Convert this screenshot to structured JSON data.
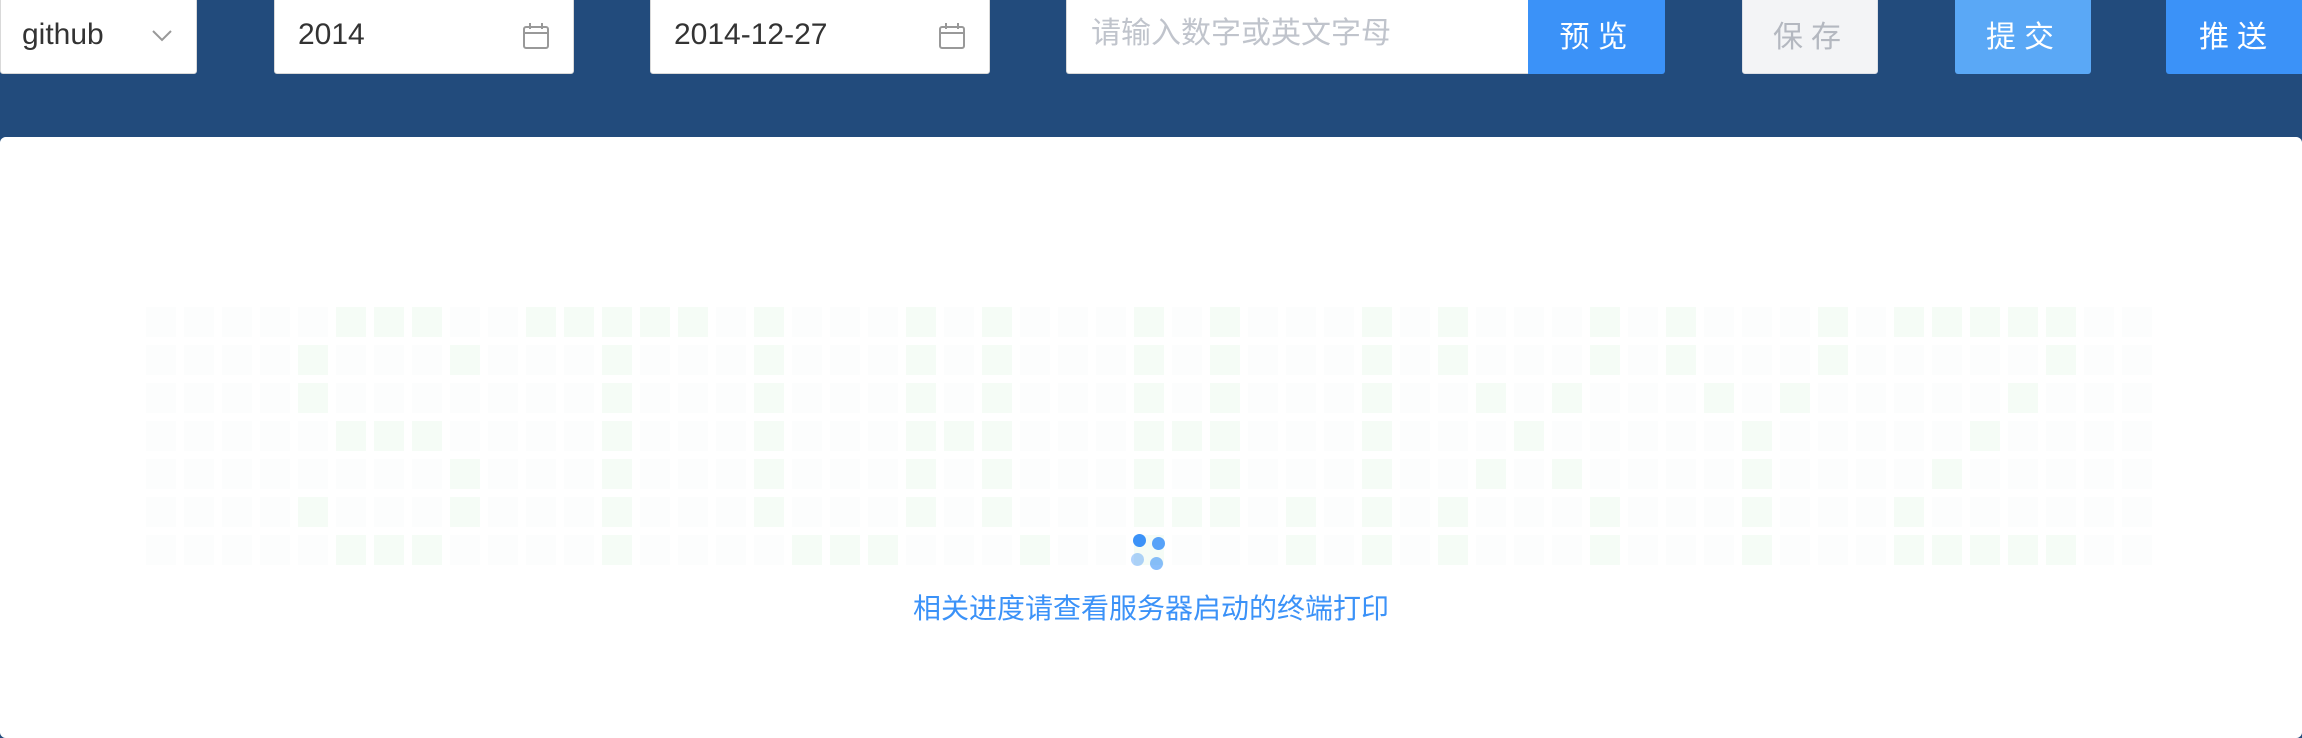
{
  "toolbar": {
    "platform_select": {
      "value": "github"
    },
    "year_picker": {
      "value": "2014"
    },
    "date_picker": {
      "value": "2014-12-27"
    },
    "text_input": {
      "value": "",
      "placeholder": "请输入数字或英文字母"
    },
    "preview_label": "预览",
    "save_label": "保存",
    "submit_label": "提交",
    "push_label": "推送"
  },
  "loading": {
    "text": "相关进度请查看服务器启动的终端打印"
  },
  "contribution_grid": {
    "active": [
      [
        0,
        0,
        0,
        0,
        0,
        1,
        1,
        1,
        0,
        0,
        1,
        1,
        1,
        1,
        1,
        0,
        1,
        0,
        0,
        0,
        1,
        0,
        1,
        0,
        0,
        0,
        1,
        0,
        1,
        0,
        0,
        0,
        1,
        0,
        1,
        0,
        0,
        0,
        1,
        0,
        1,
        0,
        0,
        0,
        1,
        0,
        1,
        1,
        1,
        1,
        1,
        0,
        0
      ],
      [
        0,
        0,
        0,
        0,
        1,
        0,
        0,
        0,
        1,
        0,
        0,
        0,
        1,
        0,
        0,
        0,
        1,
        0,
        0,
        0,
        1,
        0,
        1,
        0,
        0,
        0,
        1,
        0,
        1,
        0,
        0,
        0,
        1,
        0,
        1,
        0,
        0,
        0,
        1,
        0,
        1,
        0,
        0,
        0,
        1,
        0,
        0,
        0,
        0,
        0,
        1,
        0,
        0
      ],
      [
        0,
        0,
        0,
        0,
        1,
        0,
        0,
        0,
        0,
        0,
        0,
        0,
        1,
        0,
        0,
        0,
        1,
        0,
        0,
        0,
        1,
        0,
        1,
        0,
        0,
        0,
        1,
        0,
        1,
        0,
        0,
        0,
        1,
        0,
        0,
        1,
        0,
        1,
        0,
        0,
        0,
        1,
        0,
        1,
        0,
        0,
        0,
        0,
        0,
        1,
        0,
        0,
        0
      ],
      [
        0,
        0,
        0,
        0,
        0,
        1,
        1,
        1,
        0,
        0,
        0,
        0,
        1,
        0,
        0,
        0,
        1,
        0,
        0,
        0,
        1,
        1,
        1,
        0,
        0,
        0,
        1,
        1,
        1,
        0,
        0,
        0,
        1,
        0,
        0,
        0,
        1,
        0,
        0,
        0,
        0,
        0,
        1,
        0,
        0,
        0,
        0,
        0,
        1,
        0,
        0,
        0,
        0
      ],
      [
        0,
        0,
        0,
        0,
        0,
        0,
        0,
        0,
        1,
        0,
        0,
        0,
        1,
        0,
        0,
        0,
        1,
        0,
        0,
        0,
        1,
        0,
        1,
        0,
        0,
        0,
        1,
        0,
        1,
        0,
        0,
        0,
        1,
        0,
        0,
        1,
        0,
        1,
        0,
        0,
        0,
        0,
        1,
        0,
        0,
        0,
        0,
        1,
        0,
        0,
        0,
        0,
        0
      ],
      [
        0,
        0,
        0,
        0,
        1,
        0,
        0,
        0,
        1,
        0,
        0,
        0,
        1,
        0,
        0,
        0,
        1,
        0,
        0,
        0,
        1,
        0,
        1,
        0,
        0,
        0,
        1,
        1,
        1,
        0,
        1,
        0,
        1,
        0,
        1,
        0,
        0,
        0,
        1,
        0,
        0,
        0,
        1,
        0,
        0,
        0,
        1,
        0,
        0,
        0,
        0,
        0,
        0
      ],
      [
        0,
        0,
        0,
        0,
        0,
        1,
        1,
        1,
        0,
        0,
        0,
        0,
        1,
        0,
        0,
        0,
        0,
        1,
        1,
        1,
        0,
        0,
        0,
        1,
        0,
        0,
        1,
        0,
        0,
        0,
        1,
        0,
        1,
        0,
        1,
        0,
        0,
        0,
        1,
        0,
        0,
        0,
        1,
        0,
        0,
        0,
        1,
        1,
        1,
        1,
        1,
        0,
        0
      ]
    ],
    "colors": {
      "empty": "#f7f8fa",
      "active": "#e3f6e6"
    }
  }
}
